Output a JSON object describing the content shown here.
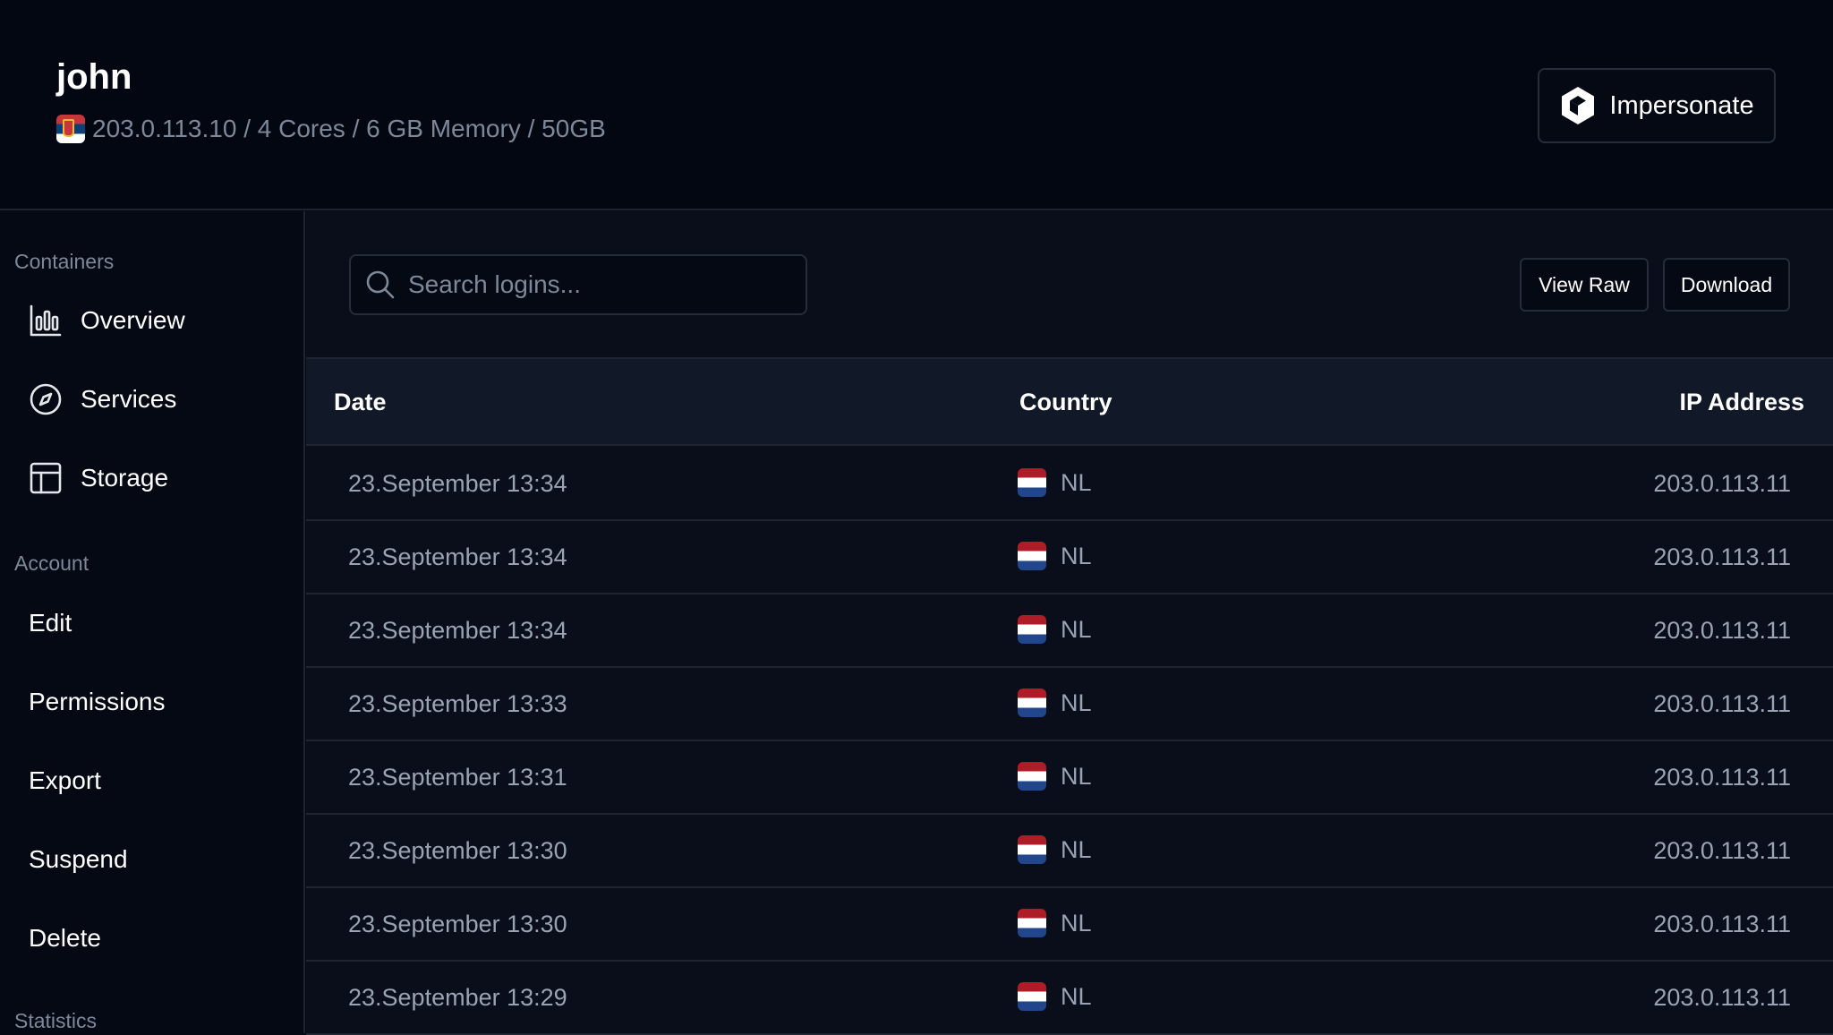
{
  "header": {
    "user_name": "john",
    "server_info": "203.0.113.10 / 4 Cores / 6 GB Memory / 50GB",
    "impersonate_label": "Impersonate"
  },
  "sidebar": {
    "containers_label": "Containers",
    "containers": [
      {
        "label": "Overview",
        "icon": "bar-chart-icon"
      },
      {
        "label": "Services",
        "icon": "compass-icon"
      },
      {
        "label": "Storage",
        "icon": "table-layout-icon"
      }
    ],
    "account_label": "Account",
    "account": [
      {
        "label": "Edit"
      },
      {
        "label": "Permissions"
      },
      {
        "label": "Export"
      },
      {
        "label": "Suspend"
      },
      {
        "label": "Delete"
      }
    ],
    "statistics_label": "Statistics"
  },
  "toolbar": {
    "search_placeholder": "Search logins...",
    "view_raw_label": "View Raw",
    "download_label": "Download"
  },
  "table": {
    "columns": [
      "Date",
      "Country",
      "IP Address"
    ],
    "rows": [
      {
        "date": "23.September 13:34",
        "country": "NL",
        "ip": "203.0.113.11"
      },
      {
        "date": "23.September 13:34",
        "country": "NL",
        "ip": "203.0.113.11"
      },
      {
        "date": "23.September 13:34",
        "country": "NL",
        "ip": "203.0.113.11"
      },
      {
        "date": "23.September 13:33",
        "country": "NL",
        "ip": "203.0.113.11"
      },
      {
        "date": "23.September 13:31",
        "country": "NL",
        "ip": "203.0.113.11"
      },
      {
        "date": "23.September 13:30",
        "country": "NL",
        "ip": "203.0.113.11"
      },
      {
        "date": "23.September 13:30",
        "country": "NL",
        "ip": "203.0.113.11"
      },
      {
        "date": "23.September 13:29",
        "country": "NL",
        "ip": "203.0.113.11"
      }
    ]
  },
  "colors": {
    "background": "#050914",
    "panel": "#0a0e1a",
    "table_header": "#111827",
    "border": "#1e2430",
    "muted_text": "#7d8899"
  }
}
